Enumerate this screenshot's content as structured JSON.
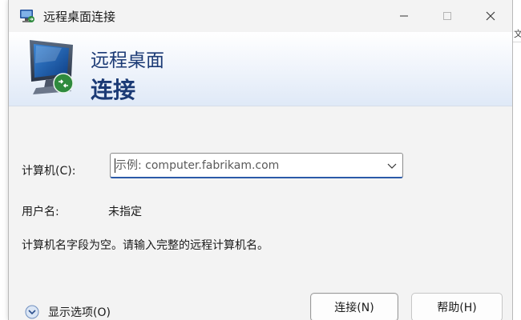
{
  "window": {
    "title": "远程桌面连接",
    "icon": "remote-desktop-icon"
  },
  "controls": {
    "minimize": "minimize-icon",
    "maximize": "maximize-icon",
    "close": "close-icon"
  },
  "banner": {
    "line1": "远程桌面",
    "line2": "连接",
    "text_color": "#1b3a75"
  },
  "form": {
    "computer_label": "计算机(C):",
    "computer_placeholder": "示例: computer.fabrikam.com",
    "computer_value": "",
    "user_label": "用户名:",
    "user_value": "未指定",
    "message": "计算机名字段为空。请输入完整的远程计算机名。"
  },
  "footer": {
    "options_label": "显示选项(O)",
    "connect_label": "连接(N)",
    "help_label": "帮助(H)"
  },
  "edge": {
    "glyph": "文"
  }
}
